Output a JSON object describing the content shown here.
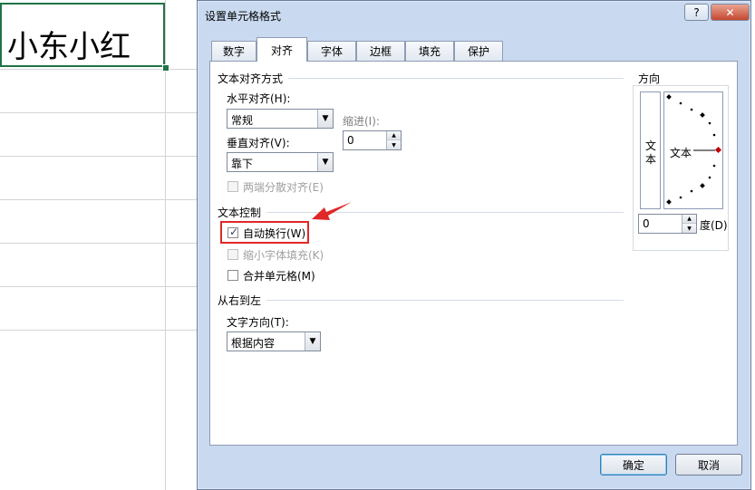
{
  "sheet": {
    "cell_text": "小东小红"
  },
  "dialog": {
    "title": "设置单元格格式",
    "help_label": "?",
    "close_label": "✕",
    "tabs": [
      "数字",
      "对齐",
      "字体",
      "边框",
      "填充",
      "保护"
    ],
    "active_tab": "对齐",
    "text_alignment": {
      "group_title": "文本对齐方式",
      "horizontal_label": "水平对齐(H):",
      "horizontal_value": "常规",
      "vertical_label": "垂直对齐(V):",
      "vertical_value": "靠下",
      "indent_label": "缩进(I):",
      "indent_value": "0",
      "justify_distributed_label": "两端分散对齐(E)"
    },
    "text_control": {
      "group_title": "文本控制",
      "wrap_text_label": "自动换行(W)",
      "wrap_text_checked": true,
      "shrink_to_fit_label": "缩小字体填充(K)",
      "merge_cells_label": "合并单元格(M)"
    },
    "rtl": {
      "group_title": "从右到左",
      "direction_label": "文字方向(T):",
      "direction_value": "根据内容"
    },
    "orientation": {
      "group_title": "方向",
      "vertical_text": [
        "文",
        "本"
      ],
      "dial_text": "文本",
      "degrees_value": "0",
      "degrees_label": "度(D)"
    },
    "buttons": {
      "ok": "确定",
      "cancel": "取消"
    },
    "colors": {
      "highlight": "#e02828",
      "accent": "#217346"
    }
  }
}
